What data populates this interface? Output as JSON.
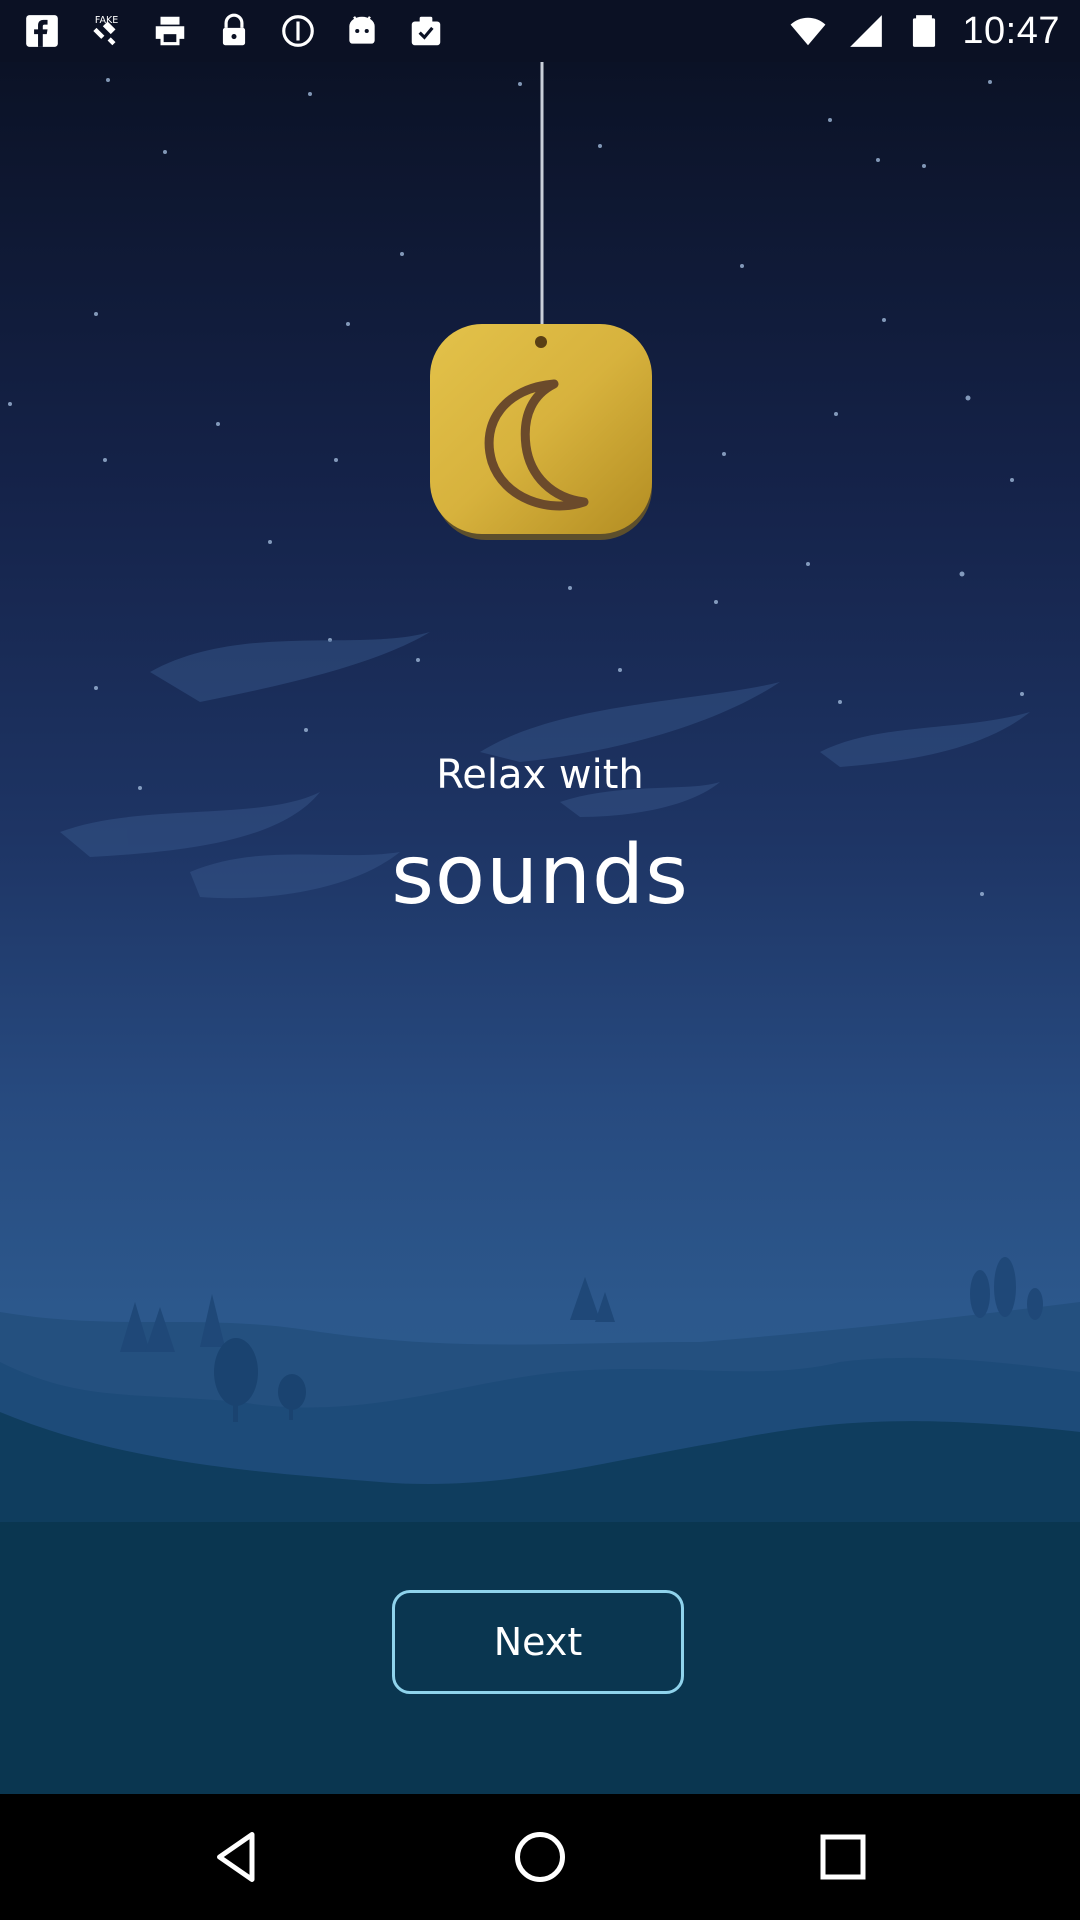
{
  "status_bar": {
    "time": "10:47",
    "left_icons": [
      "facebook-icon",
      "fake-gps-icon",
      "print-icon",
      "lock-icon",
      "info-icon",
      "android-icon",
      "clipboard-check-icon"
    ],
    "right_icons": [
      "wifi-icon",
      "signal-icon",
      "battery-icon"
    ]
  },
  "content": {
    "headline_small": "Relax with",
    "headline_large": "sounds",
    "next_label": "Next",
    "pendant_icon": "moon-icon"
  },
  "nav_bar": {
    "icons": [
      "back-icon",
      "home-icon",
      "recents-icon"
    ]
  },
  "colors": {
    "sky_top": "#0b1226",
    "sky_mid": "#274a7f",
    "ground": "#0a3650",
    "pendant": "#d8b63c",
    "moon_stroke": "#6b4a2b",
    "button_border": "#8fd3ec"
  }
}
